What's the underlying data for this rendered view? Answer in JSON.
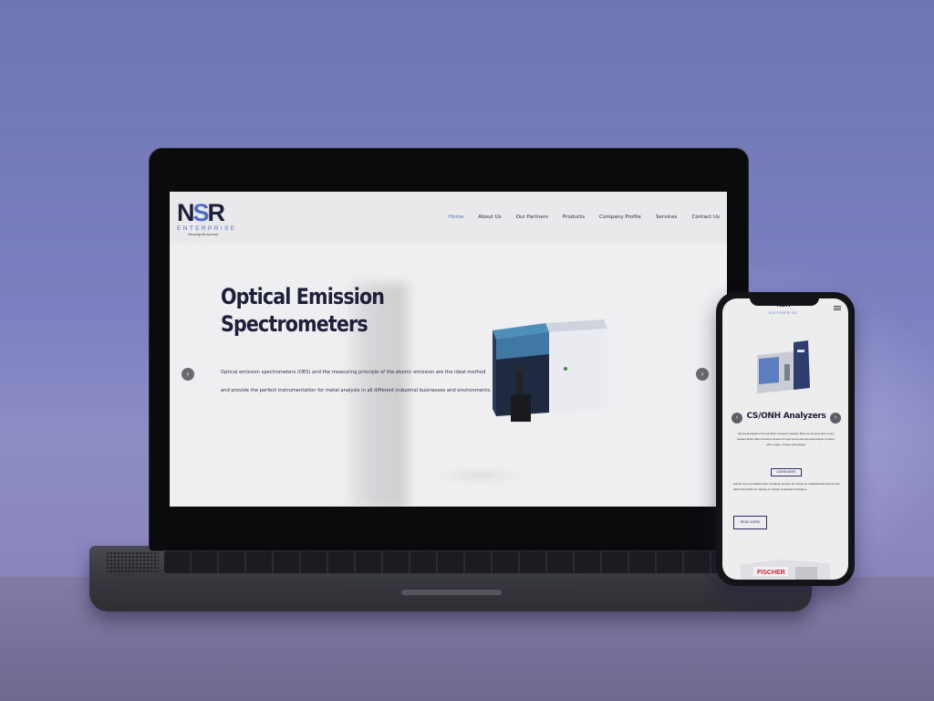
{
  "site": {
    "logo": {
      "main_1": "N",
      "main_s": "S",
      "main_2": "R",
      "sub": "ENTERPRISE",
      "tagline": "Securing the success"
    },
    "nav": [
      "Home",
      "About Us",
      "Our Partners",
      "Products",
      "Company Profile",
      "Services",
      "Contact Us"
    ],
    "active_nav": "Home",
    "hero": {
      "title": "Optical Emission Spectrometers",
      "description_line1": "Optical emission spectrometers (OES) and the measuring principle of the atomic emission are the ideal method",
      "description_line2": "and provide the perfect instrumentation for metal analysis in all different industrial businesses and environments."
    },
    "arrows": {
      "prev": "‹",
      "next": "›"
    }
  },
  "phone": {
    "logo": "NSR",
    "logo_sub": "ENTERPRISE",
    "slide_title": "CS/ONH Analyzers",
    "slide_desc": "Elemental analysis of CS and ONH in inorganic materials | Based on the know-how of many decades Bruker offers innovative solutions for rapid and precise elemental analysis of carbon, sulfur, oxygen, nitrogen and hydrogen.",
    "learn_more": "LEARN MORE",
    "about_text": "started as a consultancy firm providing services for setting up analytical laboratories and delivering hands-on training on various analytical techniques.",
    "read_more": "READ MORE",
    "booth_label": "FISCHER"
  },
  "colors": {
    "brand_dark": "#1e1f3a",
    "brand_blue": "#4d6fc9",
    "background": "#7c80c0"
  },
  "icons": [
    "chevron-left-icon",
    "chevron-right-icon",
    "hamburger-menu-icon"
  ]
}
